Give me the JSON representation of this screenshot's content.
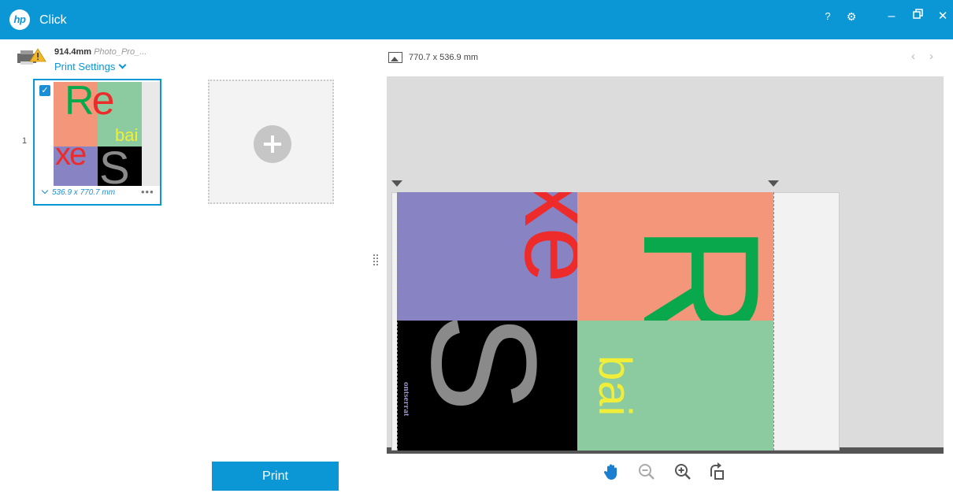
{
  "app": {
    "title": "Click",
    "logo_text": "hp"
  },
  "titlebar": {
    "help": "?",
    "settings": "⚙",
    "minimize": "–",
    "restore": "🗗",
    "close": "✕"
  },
  "printer": {
    "roll_size": "914.4mm",
    "media": "Photo_Pro_...",
    "settings_label": "Print Settings"
  },
  "job_list": {
    "items": [
      {
        "index": "1",
        "selected": true,
        "size": "536.9 x 770.7 mm",
        "more": "•••"
      }
    ],
    "thumb_text": {
      "re": "Re",
      "bai": "bai",
      "xe": "xe",
      "s": "S"
    }
  },
  "actions": {
    "print_label": "Print"
  },
  "preview": {
    "media_dims": "770.7 x 536.9 mm",
    "prev": "‹",
    "next": "›",
    "image_text": {
      "xe": "xe",
      "re": "Re",
      "s": "S",
      "bai": "bai",
      "logo": "ontserrat"
    }
  },
  "colors": {
    "accent": "#0b96d6",
    "salmon": "#f4967a",
    "green_quad": "#8ccb9f",
    "purple": "#8883c2",
    "black": "#000000",
    "text_red": "#ee2b2b",
    "text_green": "#0aa84c",
    "text_yellow": "#f1ee3a",
    "text_gray": "#8a8a8a"
  },
  "toolbar": {
    "icons": [
      "hand-icon",
      "zoom-out-icon",
      "zoom-in-icon",
      "rotate-icon"
    ]
  }
}
